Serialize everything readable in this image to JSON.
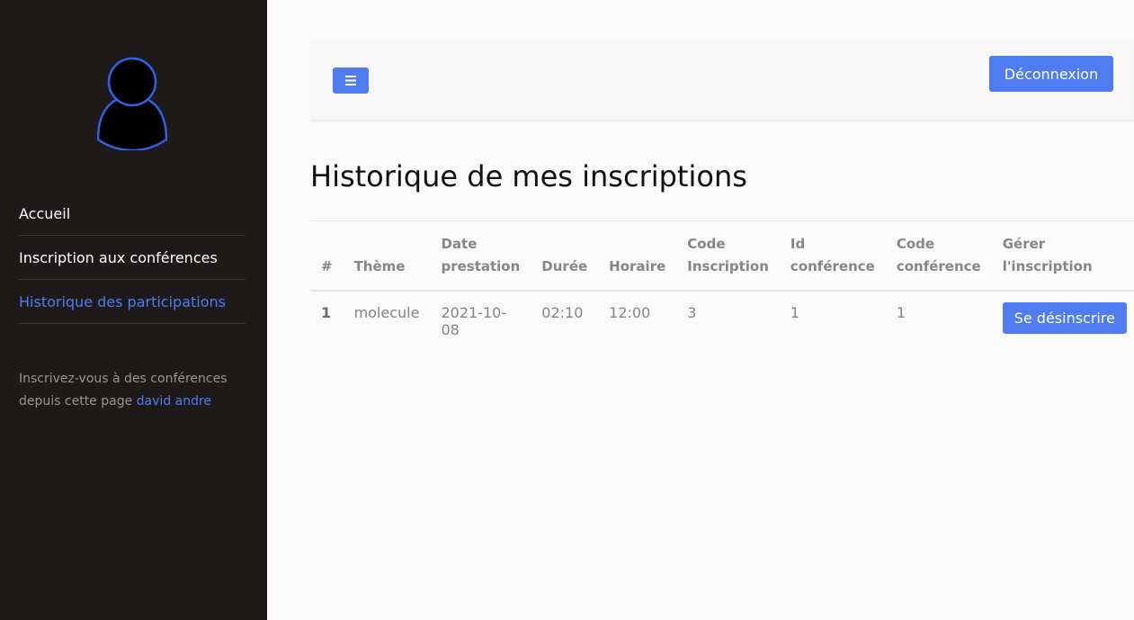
{
  "sidebar": {
    "nav": [
      {
        "label": "Accueil"
      },
      {
        "label": "Inscription aux conférences"
      },
      {
        "label": "Historique des participations"
      }
    ],
    "note_prefix": "Inscrivez-vous à des conférences depuis cette page",
    "user_name": "david andre"
  },
  "topbar": {
    "menu_icon": "bars-icon",
    "logout_label": "Déconnexion"
  },
  "page_title": "Historique de mes inscriptions",
  "table": {
    "columns": [
      "#",
      "Thème",
      "Date prestation",
      "Durée",
      "Horaire",
      "Code Inscription",
      "Id conférence",
      "Code conférence",
      "Gérer l'inscription"
    ],
    "rows": [
      {
        "index": "1",
        "theme": "molecule",
        "date": "2021-10-08",
        "duree": "02:10",
        "horaire": "12:00",
        "code_inscription": "3",
        "id_conference": "1",
        "code_conference": "1",
        "action_label": "Se désinscrire"
      }
    ]
  },
  "colors": {
    "accent": "#4f7cf0",
    "sidebar_bg": "#1f1a1a"
  }
}
